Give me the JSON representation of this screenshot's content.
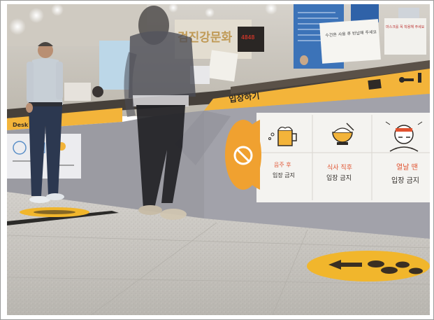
{
  "scene": {
    "banner_label": "입장하기",
    "desk_label": "Desk",
    "wall_sign": "검진강문화",
    "counter_display": "4848",
    "posters": [
      "수건은 사용 후 반납해 주세요",
      "마스크를 꼭 착용해 주세요"
    ],
    "pictograms": [
      {
        "name": "no-entry",
        "line1": "",
        "line2": ""
      },
      {
        "name": "beer",
        "line1": "음주 후",
        "line2": "입장 금지"
      },
      {
        "name": "rice-bowl",
        "line1": "식사 직후",
        "line2": "입장 금지"
      },
      {
        "name": "fever",
        "line1": "열날 땐",
        "line2": "입장 금지"
      }
    ]
  },
  "colors": {
    "accent_yellow": "#f3b43a",
    "panel_gray": "#9b9ba2",
    "sign_orange": "#f0a130",
    "text_red": "#e0522f",
    "floor": "#c9c6c1"
  }
}
